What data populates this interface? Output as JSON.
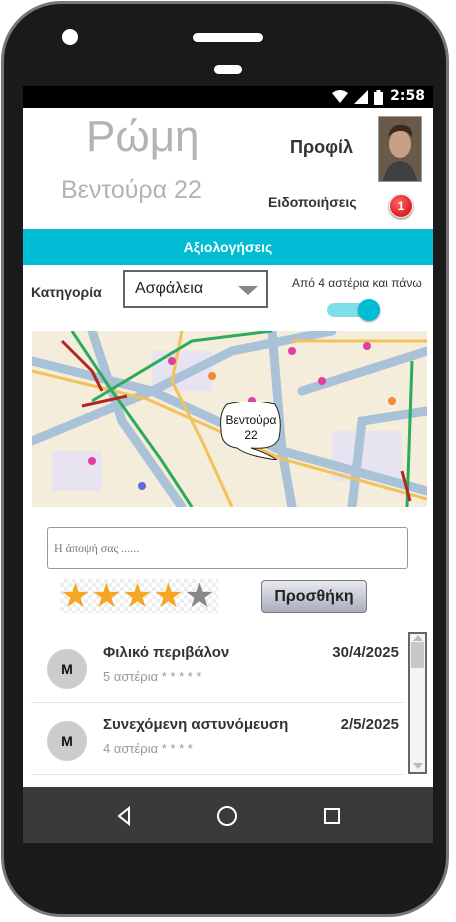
{
  "status": {
    "time": "2:58"
  },
  "header": {
    "city": "Ρώμη",
    "address": "Βεντούρα 22",
    "profile_label": "Προφίλ",
    "notifications_label": "Ειδοποιήσεις",
    "notifications_count": "1"
  },
  "section_title": "Αξιολογήσεις",
  "filter": {
    "category_label": "Κατηγορία",
    "category_selected": "Ασφάλεια",
    "min_stars_label": "Από 4 αστέρια και πάνω",
    "toggle_on": true
  },
  "map": {
    "pin_label_line1": "Βεντούρα",
    "pin_label_line2": "22"
  },
  "opinion": {
    "placeholder": "Η άποψή σας ......"
  },
  "rating": {
    "value": 4,
    "max": 5
  },
  "add_button_label": "Προσθήκη",
  "reviews": [
    {
      "initial": "M",
      "title": "Φιλικό περιβάλον",
      "date": "30/4/2025",
      "stars_text": "5 αστέρια * * * * *"
    },
    {
      "initial": "M",
      "title": " Συνεχόμενη αστυνόμευση",
      "date": "2/5/2025",
      "stars_text": "4 αστέρια * * * *"
    }
  ],
  "colors": {
    "accent": "#00bcd4",
    "star_on": "#f5a623",
    "star_off": "#888888",
    "badge": "#dd1111"
  },
  "icons": [
    "wifi-icon",
    "signal-icon",
    "battery-icon",
    "back-icon",
    "home-icon",
    "recents-icon",
    "dropdown-arrow-icon"
  ]
}
